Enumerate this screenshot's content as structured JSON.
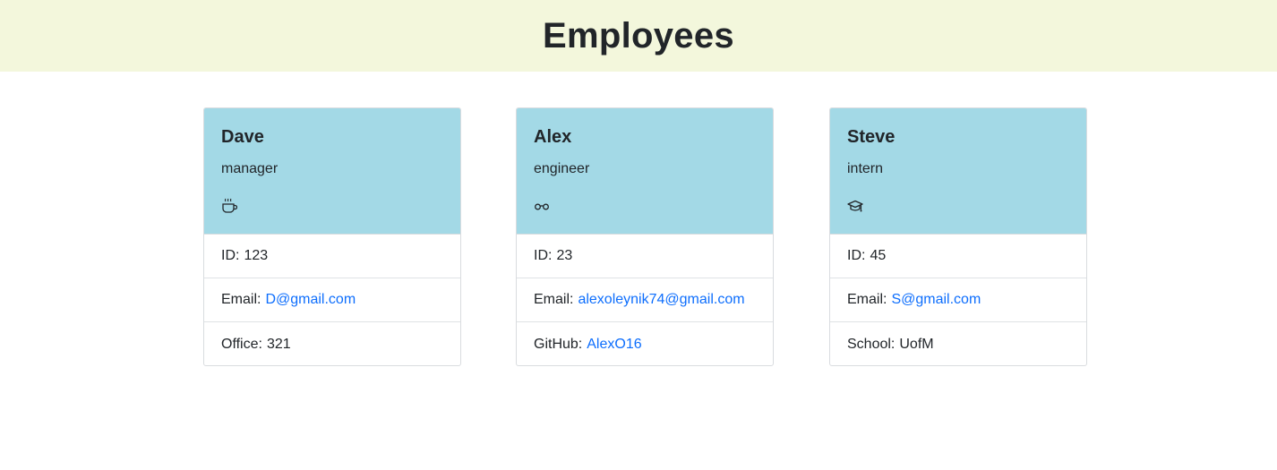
{
  "header": {
    "title": "Employees"
  },
  "colors": {
    "banner": "#f3f7dc",
    "card_header": "#a3d9e6",
    "link": "#0d6efd"
  },
  "employees": [
    {
      "name": "Dave",
      "role": "manager",
      "icon": "coffee-cup-icon",
      "id_label": "ID:",
      "id_value": "123",
      "email_label": "Email:",
      "email_value": "D@gmail.com",
      "extra_label": "Office:",
      "extra_value": "321"
    },
    {
      "name": "Alex",
      "role": "engineer",
      "icon": "glasses-icon",
      "id_label": "ID:",
      "id_value": "23",
      "email_label": "Email:",
      "email_value": "alexoleynik74@gmail.com",
      "extra_label": "GitHub:",
      "extra_value": "AlexO16"
    },
    {
      "name": "Steve",
      "role": "intern",
      "icon": "graduation-cap-icon",
      "id_label": "ID:",
      "id_value": "45",
      "email_label": "Email:",
      "email_value": "S@gmail.com",
      "extra_label": "School:",
      "extra_value": "UofM"
    }
  ]
}
